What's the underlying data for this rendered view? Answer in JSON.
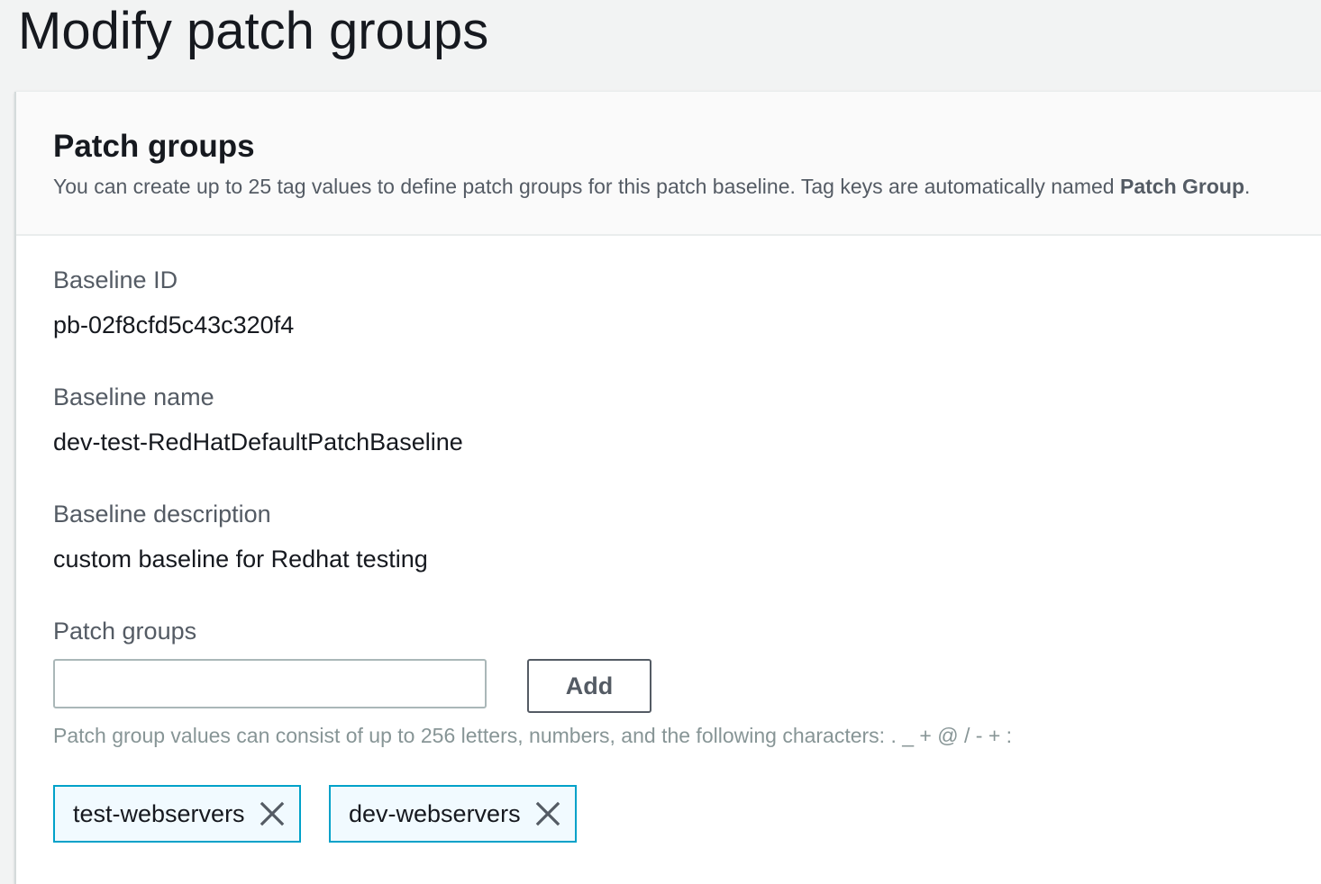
{
  "page": {
    "title": "Modify patch groups"
  },
  "panel": {
    "heading": "Patch groups",
    "description_prefix": "You can create up to 25 tag values to define patch groups for this patch baseline. Tag keys are automatically named ",
    "description_bold": "Patch Group",
    "description_suffix": "."
  },
  "fields": {
    "baseline_id": {
      "label": "Baseline ID",
      "value": "pb-02f8cfd5c43c320f4"
    },
    "baseline_name": {
      "label": "Baseline name",
      "value": "dev-test-RedHatDefaultPatchBaseline"
    },
    "baseline_description": {
      "label": "Baseline description",
      "value": "custom baseline for Redhat testing"
    }
  },
  "patch_groups": {
    "label": "Patch groups",
    "input_value": "",
    "add_label": "Add",
    "hint": "Patch group values can consist of up to 256 letters, numbers, and the following characters: . _ + @ / - + :",
    "tokens": [
      {
        "label": "test-webservers",
        "remove_icon": "close-icon"
      },
      {
        "label": "dev-webservers",
        "remove_icon": "close-icon"
      }
    ]
  },
  "colors": {
    "token_border": "#00a1c9",
    "token_background": "#f1faff"
  }
}
